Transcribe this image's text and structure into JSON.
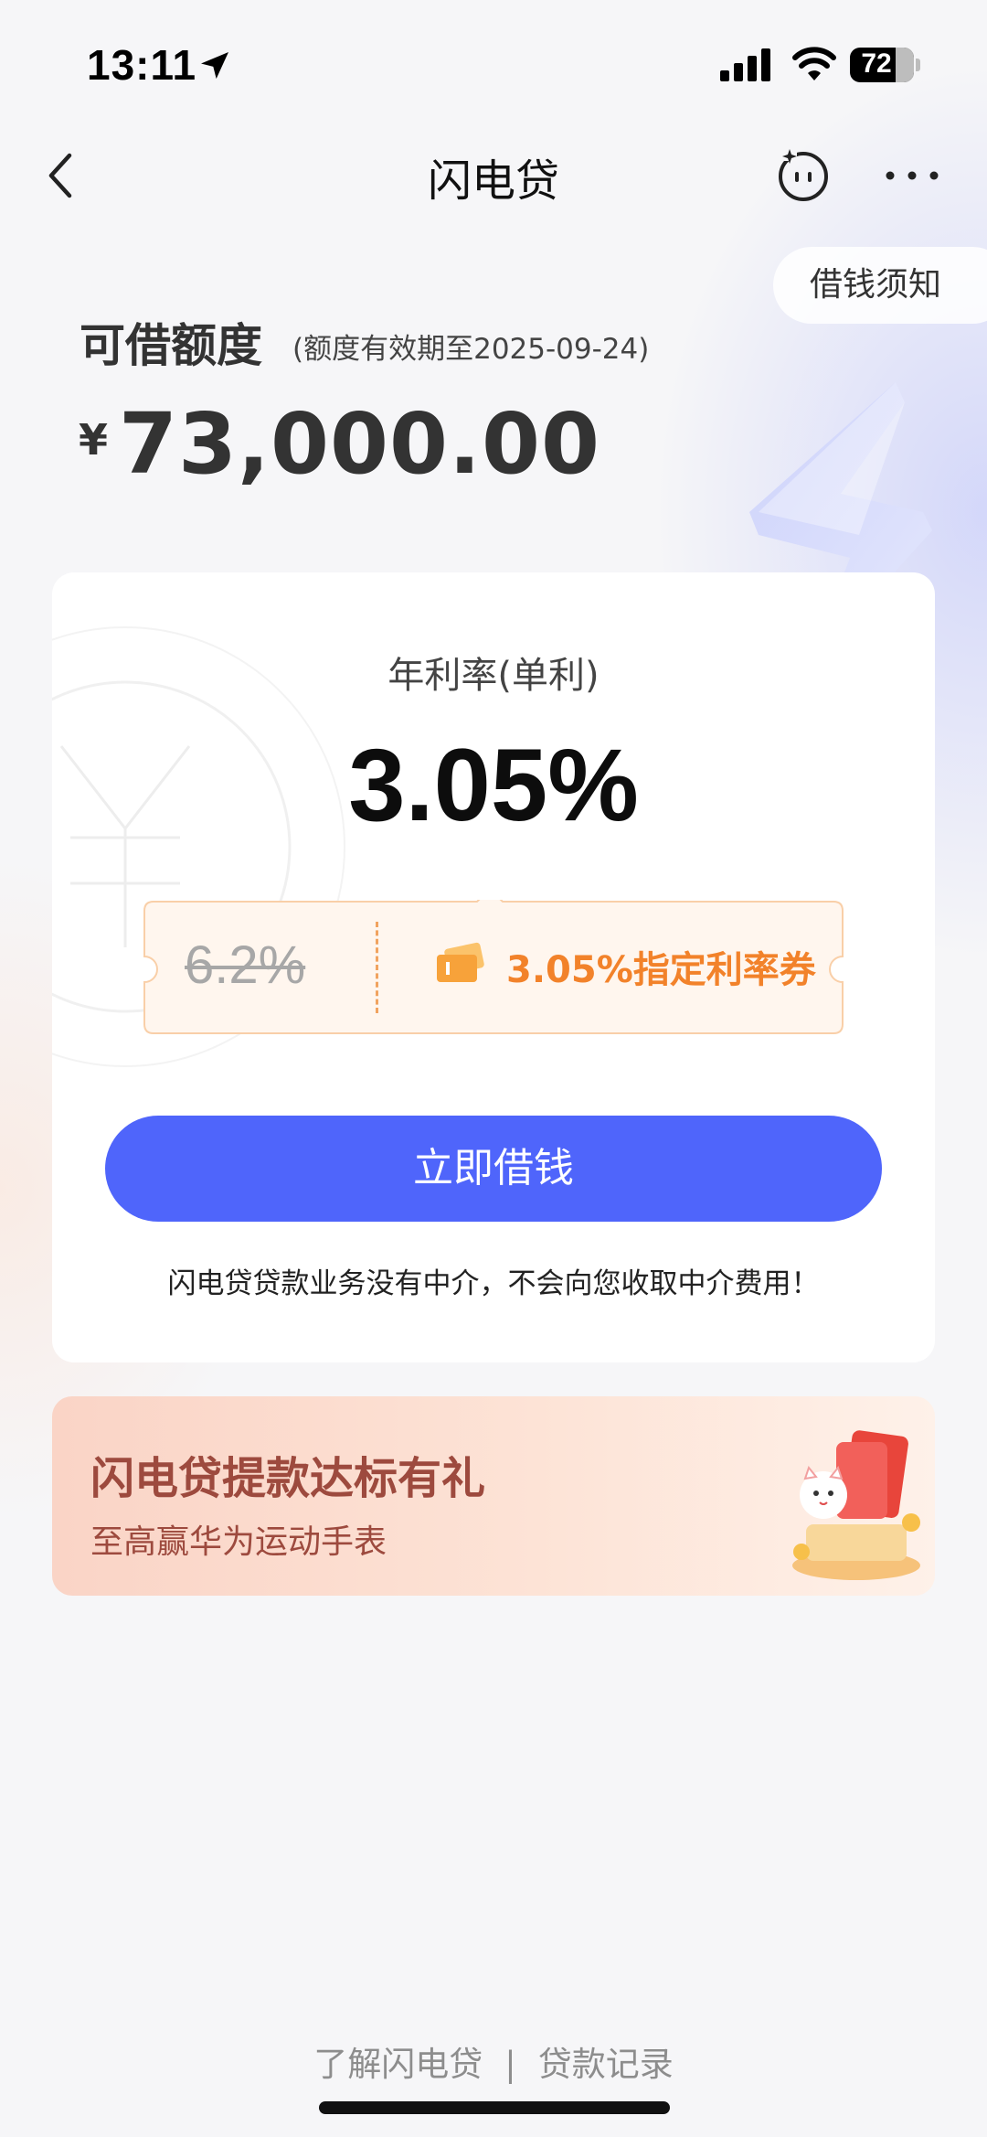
{
  "status_bar": {
    "time": "13:11",
    "battery": "72",
    "battery_level_percent": 72
  },
  "nav": {
    "title": "闪电贷"
  },
  "notice_button": "借钱须知",
  "credit": {
    "label": "可借额度",
    "validity": "(额度有效期至2025-09-24)",
    "currency_symbol": "¥",
    "amount": "73,000.00"
  },
  "rate_card": {
    "rate_label": "年利率(单利)",
    "rate_value": "3.05%",
    "original_rate": "6.2%",
    "coupon_text": "3.05%指定利率券",
    "borrow_button": "立即借钱",
    "disclaimer": "闪电贷贷款业务没有中介，不会向您收取中介费用！"
  },
  "promo": {
    "title": "闪电贷提款达标有礼",
    "subtitle": "至高赢华为运动手表"
  },
  "footer": {
    "link_about": "了解闪电贷",
    "separator": "|",
    "link_records": "贷款记录"
  },
  "colors": {
    "accent": "#4f65fb",
    "coupon_orange": "#f2822a",
    "promo_text": "#9d4a3e"
  },
  "icons": [
    "location-arrow-icon",
    "signal-icon",
    "wifi-icon",
    "battery-icon",
    "back-chevron-icon",
    "assistant-face-icon",
    "more-dots-icon",
    "ticket-icon"
  ]
}
